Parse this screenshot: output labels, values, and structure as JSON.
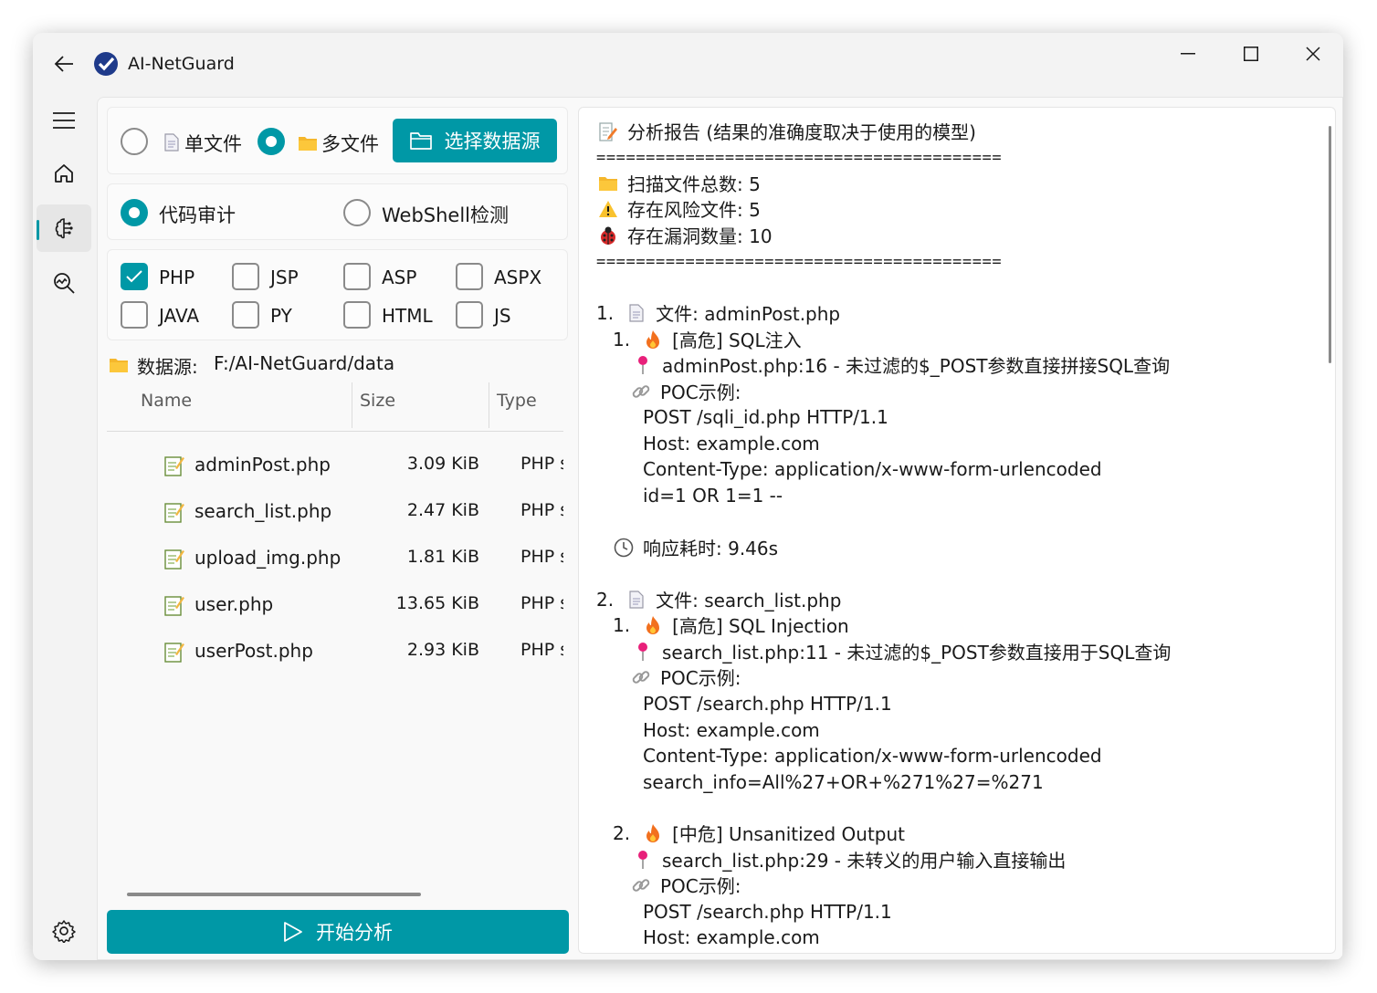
{
  "app": {
    "title": "AI-NetGuard"
  },
  "mode": {
    "single_file": "单文件",
    "multi_file": "多文件",
    "select_source": "选择数据源"
  },
  "analysis_type": {
    "code_audit": "代码审计",
    "webshell": "WebShell检测"
  },
  "languages": [
    "PHP",
    "JSP",
    "ASP",
    "ASPX",
    "JAVA",
    "PY",
    "HTML",
    "JS"
  ],
  "data_source": {
    "label": "数据源:",
    "path": "F:/AI-NetGuard/data"
  },
  "table": {
    "columns": [
      "Name",
      "Size",
      "Type"
    ],
    "rows": [
      {
        "name": "adminPost.php",
        "size": "3.09 KiB",
        "type": "PHP s"
      },
      {
        "name": "search_list.php",
        "size": "2.47 KiB",
        "type": "PHP s"
      },
      {
        "name": "upload_img.php",
        "size": "1.81 KiB",
        "type": "PHP s"
      },
      {
        "name": "user.php",
        "size": "13.65 KiB",
        "type": "PHP s"
      },
      {
        "name": "userPost.php",
        "size": "2.93 KiB",
        "type": "PHP s"
      }
    ]
  },
  "start_button": "开始分析",
  "report": {
    "title": "分析报告 (结果的准确度取决于使用的模型)",
    "separator": "=========================================",
    "total_files": "扫描文件总数: 5",
    "risk_files": "存在风险文件: 5",
    "vuln_count": "存在漏洞数量: 10",
    "f1_num": "1.",
    "f1_file": "文件: adminPost.php",
    "f1_i1_num": "1.",
    "f1_i1_title": "[高危] SQL注入",
    "f1_i1_loc": "adminPost.php:16 - 未过滤的$_POST参数直接拼接SQL查询",
    "poc_label": "POC示例:",
    "f1_i1_poc1": "POST /sqli_id.php HTTP/1.1",
    "f1_i1_poc2": "Host: example.com",
    "f1_i1_poc3": "Content-Type: application/x-www-form-urlencoded",
    "f1_i1_poc4": "id=1 OR 1=1 --",
    "response_time": "响应耗时: 9.46s",
    "f2_num": "2.",
    "f2_file": "文件: search_list.php",
    "f2_i1_num": "1.",
    "f2_i1_title": "[高危] SQL Injection",
    "f2_i1_loc": "search_list.php:11 - 未过滤的$_POST参数直接用于SQL查询",
    "f2_i1_poc1": "POST /search.php HTTP/1.1",
    "f2_i1_poc2": "Host: example.com",
    "f2_i1_poc3": "Content-Type: application/x-www-form-urlencoded",
    "f2_i1_poc4": "search_info=All%27+OR+%271%27=%271",
    "f2_i2_num": "2.",
    "f2_i2_title": "[中危] Unsanitized Output",
    "f2_i2_loc": "search_list.php:29 - 未转义的用户输入直接输出",
    "f2_i2_poc1": "POST /search.php HTTP/1.1",
    "f2_i2_poc2": "Host: example.com"
  },
  "colors": {
    "accent": "#0098a6"
  }
}
